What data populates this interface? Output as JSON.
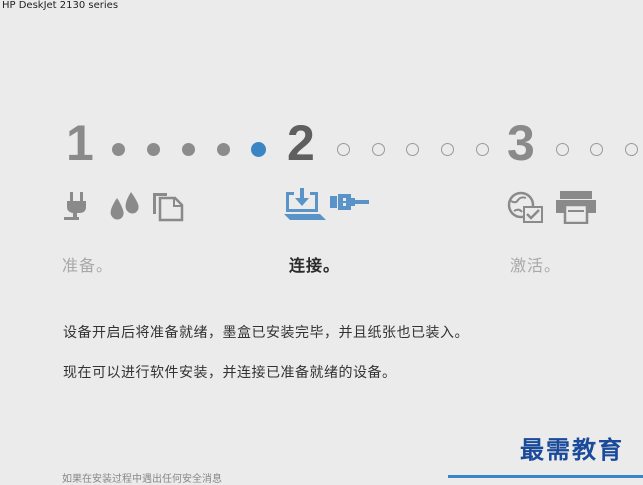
{
  "window": {
    "title": "HP DeskJet 2130 series"
  },
  "steps": [
    {
      "number": "1",
      "label": "准备。",
      "icons": [
        "power-plug-icon",
        "ink-drops-icon",
        "paper-sheets-icon"
      ]
    },
    {
      "number": "2",
      "label": "连接。",
      "icons": [
        "download-tray-icon",
        "usb-cable-icon"
      ]
    },
    {
      "number": "3",
      "label": "激活。",
      "icons": [
        "web-check-icon",
        "printer-icon"
      ]
    }
  ],
  "progress": {
    "current_step": 2
  },
  "description": {
    "line1": "设备开启后将准备就绪，墨盒已安装完毕，并且纸张也已装入。",
    "line2": "现在可以进行软件安装，并连接已准备就绪的设备。"
  },
  "footer": {
    "note": "如果在安装过程中遇出任何安全消息"
  },
  "watermark": {
    "text": "最需教育"
  },
  "colors": {
    "accent": "#3b85c5",
    "number": "#8a8a8a",
    "dim_text": "#a8a8a8"
  }
}
